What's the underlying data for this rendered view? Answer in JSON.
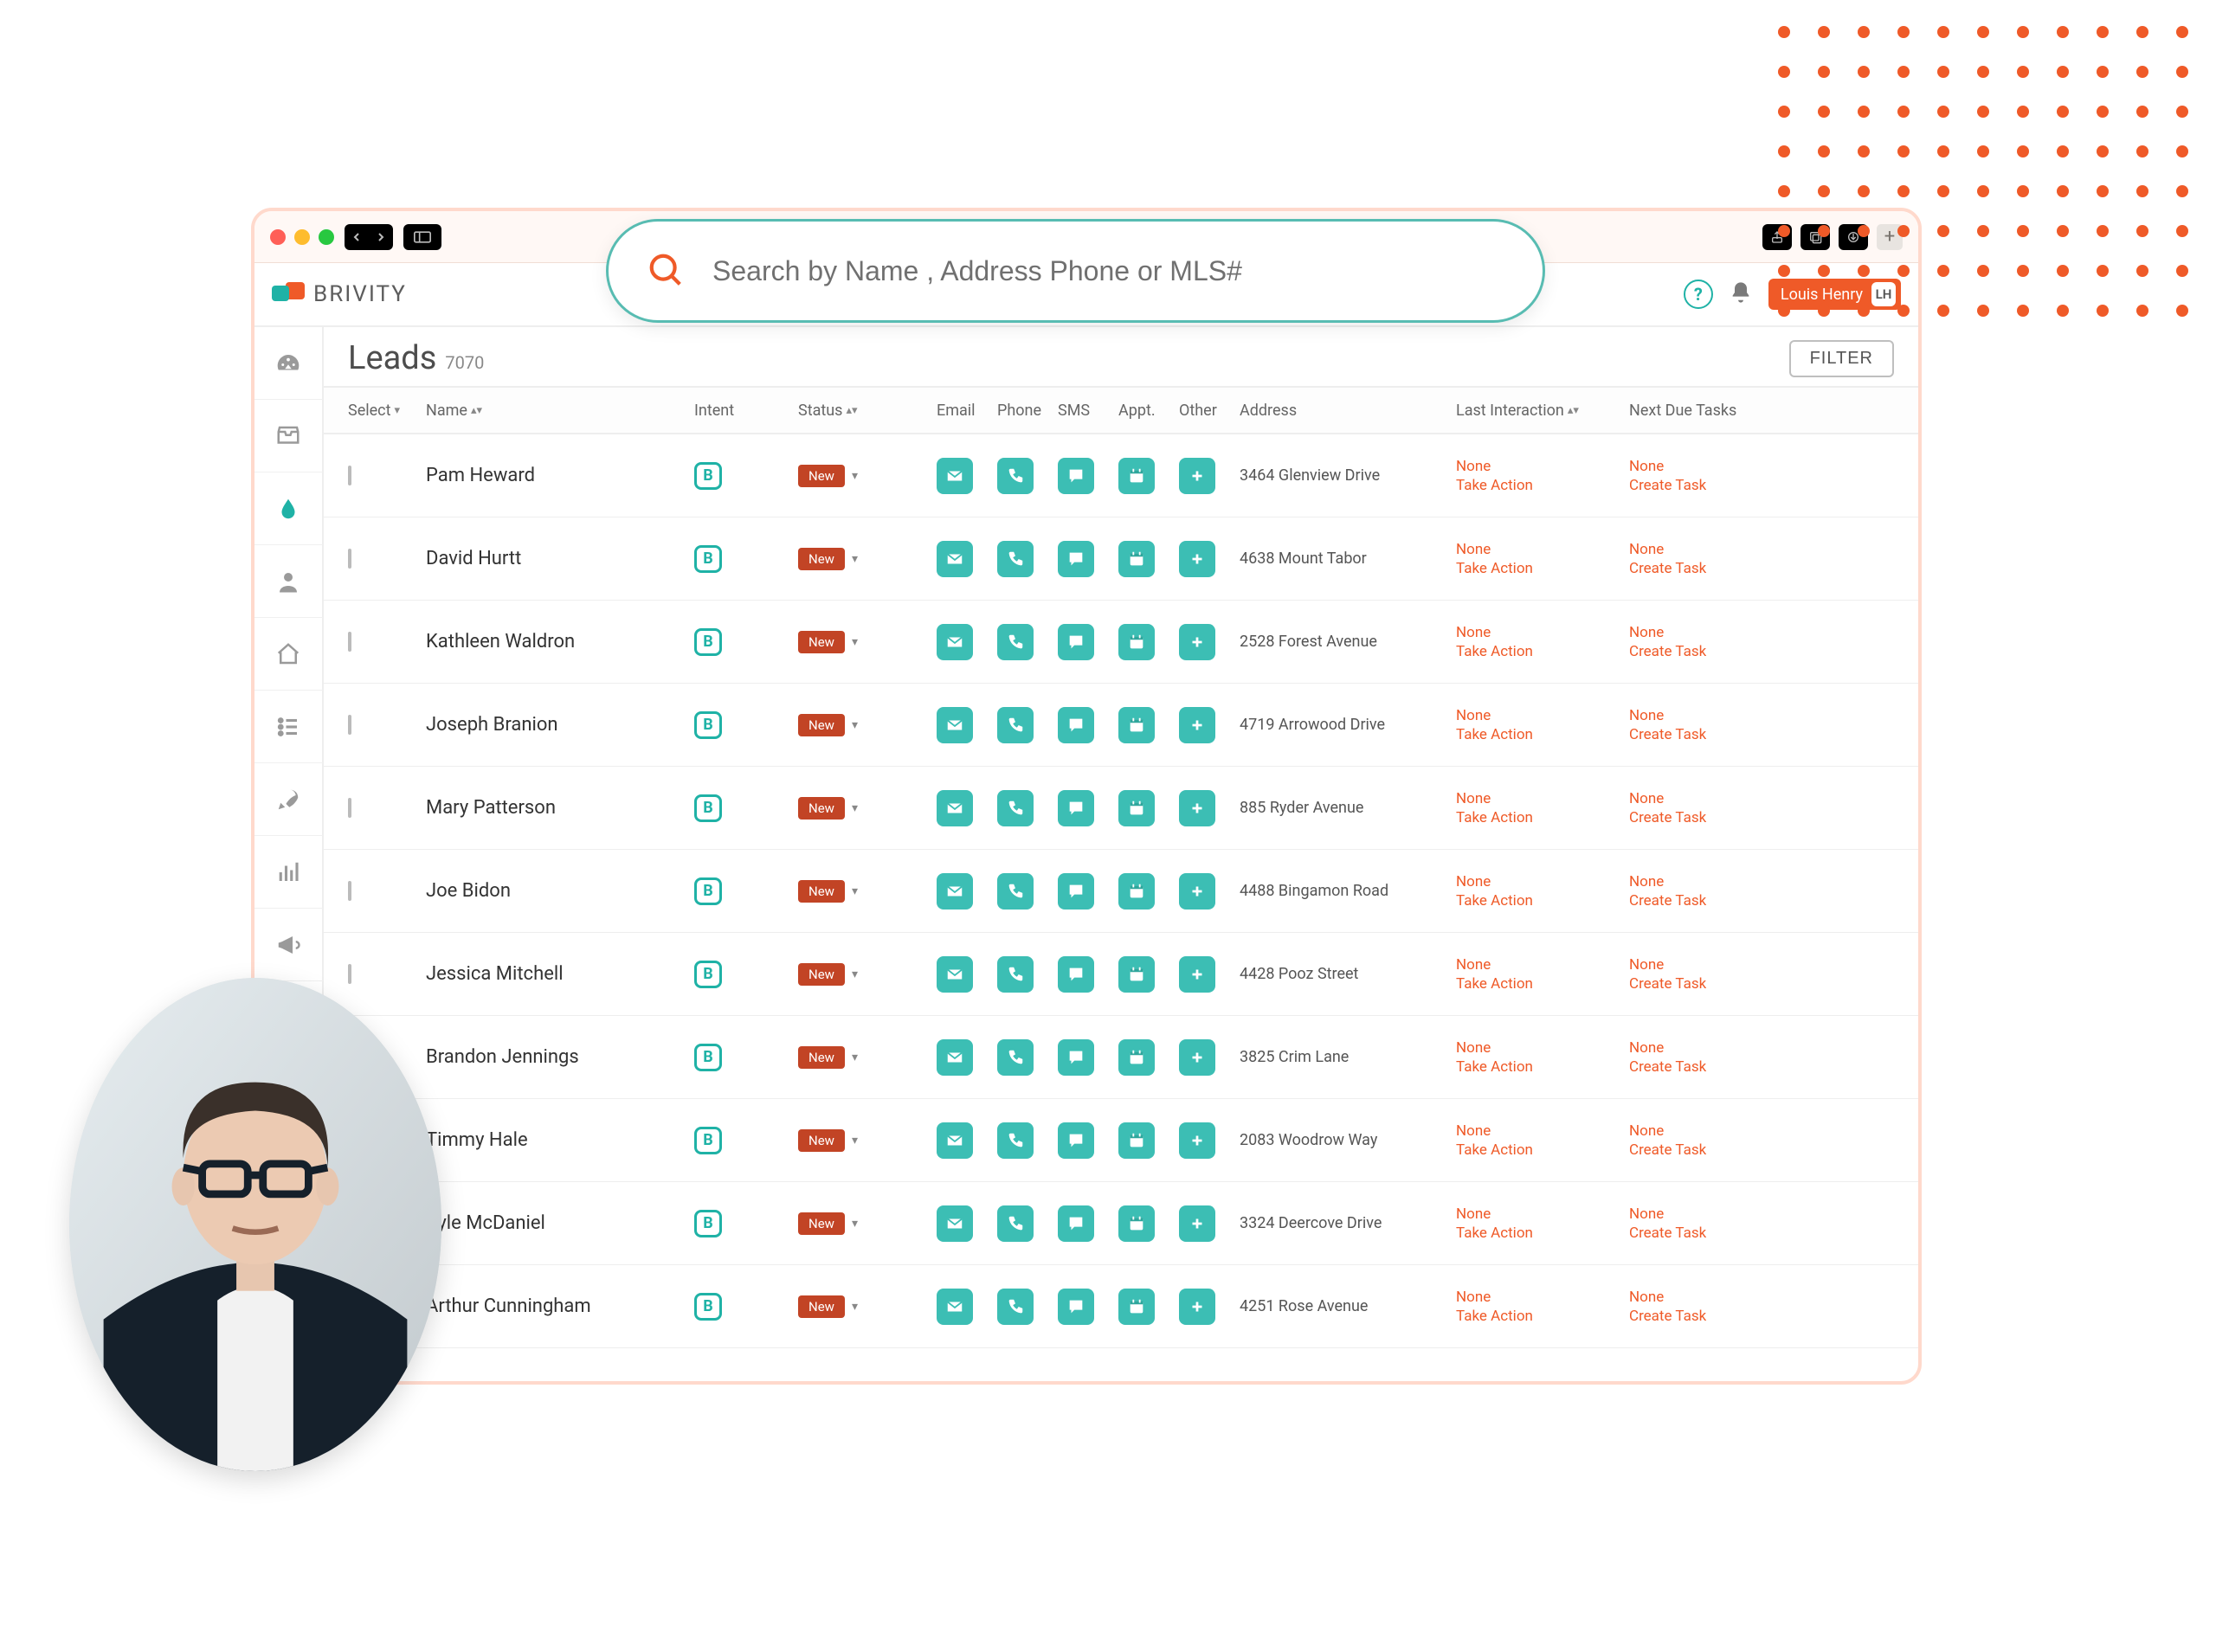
{
  "brand": {
    "name": "BRIVITY"
  },
  "search": {
    "placeholder": "Search by Name , Address Phone or MLS#"
  },
  "user": {
    "name": "Louis Henry",
    "initials": "LH"
  },
  "page": {
    "title": "Leads",
    "count": "7070",
    "filter_label": "FILTER"
  },
  "columns": {
    "select": "Select",
    "name": "Name",
    "intent": "Intent",
    "status": "Status",
    "email": "Email",
    "phone": "Phone",
    "sms": "SMS",
    "appt": "Appt.",
    "other": "Other",
    "address": "Address",
    "last": "Last Interaction",
    "next": "Next Due Tasks"
  },
  "status_label": "New",
  "intent_letter": "B",
  "interaction_none": "None",
  "interaction_action": "Take Action",
  "task_none": "None",
  "task_create": "Create Task",
  "leads": [
    {
      "name": "Pam Heward",
      "address": "3464 Glenview Drive"
    },
    {
      "name": "David Hurtt",
      "address": "4638 Mount Tabor"
    },
    {
      "name": "Kathleen Waldron",
      "address": "2528 Forest Avenue"
    },
    {
      "name": "Joseph Branion",
      "address": "4719 Arrowood Drive"
    },
    {
      "name": "Mary Patterson",
      "address": "885 Ryder Avenue"
    },
    {
      "name": "Joe Bidon",
      "address": "4488 Bingamon Road"
    },
    {
      "name": "Jessica Mitchell",
      "address": "4428 Pooz Street"
    },
    {
      "name": "Brandon Jennings",
      "address": "3825 Crim Lane"
    },
    {
      "name": "Timmy Hale",
      "address": "2083 Woodrow Way"
    },
    {
      "name": "Kyle McDaniel",
      "address": "3324 Deercove Drive"
    },
    {
      "name": "Arthur Cunningham",
      "address": "4251 Rose Avenue"
    }
  ]
}
